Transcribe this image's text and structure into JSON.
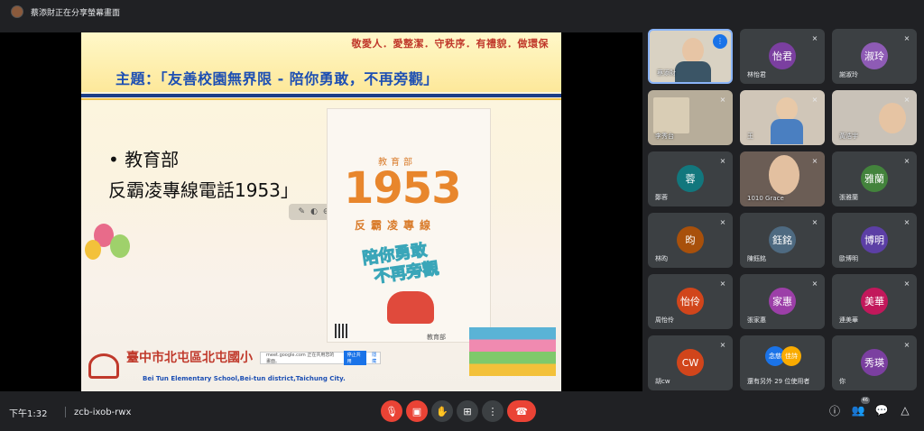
{
  "topbar": {
    "presenting_text": "蔡添財正在分享螢幕畫面"
  },
  "slide": {
    "motto": "敬愛人．愛整潔．守秩序．有禮貌．做環保",
    "theme": "主題：「友善校園無界限 - 陪你勇敢，不再旁觀」",
    "bullet_line1": "• 教育部",
    "bullet_line2": "反霸凌專線電話1953」",
    "poster": {
      "tag": "教育部",
      "number": "1953",
      "subtitle": "反霸凌專線",
      "slogan_line1": "陪你勇敢",
      "slogan_line2": "不再旁觀",
      "org": "教育部"
    },
    "school_name": "臺中市北屯區北屯國小",
    "school_en": "Bei Tun Elementary School,Bei-tun district,Taichung City.",
    "share_bar": {
      "text": "meet.google.com 正在共用您的畫面。",
      "stop": "停止共用",
      "hide": "隱藏"
    }
  },
  "participants": [
    {
      "name": "蔡添財",
      "initials": "",
      "type": "video",
      "speaking": true
    },
    {
      "name": "林怡君",
      "initials": "怡君",
      "color": "#7b3fa0"
    },
    {
      "name": "謝淑玲",
      "initials": "淑玲",
      "color": "#8e5bb5"
    },
    {
      "name": "李秀台",
      "initials": "",
      "type": "video"
    },
    {
      "name": "王",
      "initials": "",
      "type": "video"
    },
    {
      "name": "黃浩宇",
      "initials": "",
      "type": "video"
    },
    {
      "name": "鄭蓉",
      "initials": "蓉",
      "color": "#12777d"
    },
    {
      "name": "1010 Grace",
      "initials": "",
      "type": "video"
    },
    {
      "name": "張雅蘭",
      "initials": "雅蘭",
      "color": "#43833c"
    },
    {
      "name": "林昀",
      "initials": "昀",
      "color": "#a8500b"
    },
    {
      "name": "陳鈺銘",
      "initials": "鈺銘",
      "color": "#4e6a81"
    },
    {
      "name": "歐博明",
      "initials": "博明",
      "color": "#5c3fa5"
    },
    {
      "name": "周怡伶",
      "initials": "怡伶",
      "color": "#d1451b"
    },
    {
      "name": "張家惠",
      "initials": "家惠",
      "color": "#9c3fa8"
    },
    {
      "name": "連美華",
      "initials": "美華",
      "color": "#c2185b"
    },
    {
      "name": "胡cw",
      "initials": "CW",
      "color": "#d1451b"
    },
    {
      "name": "還有另外 29 位使用者",
      "initials": "",
      "type": "more",
      "badges": [
        "念慈",
        "佳詩"
      ]
    },
    {
      "name": "你",
      "initials": "秀瑛",
      "color": "#7b3fa0"
    }
  ],
  "bottombar": {
    "time": "下午1:32",
    "meeting_code": "zcb-ixob-rwx",
    "participant_count": "46"
  }
}
